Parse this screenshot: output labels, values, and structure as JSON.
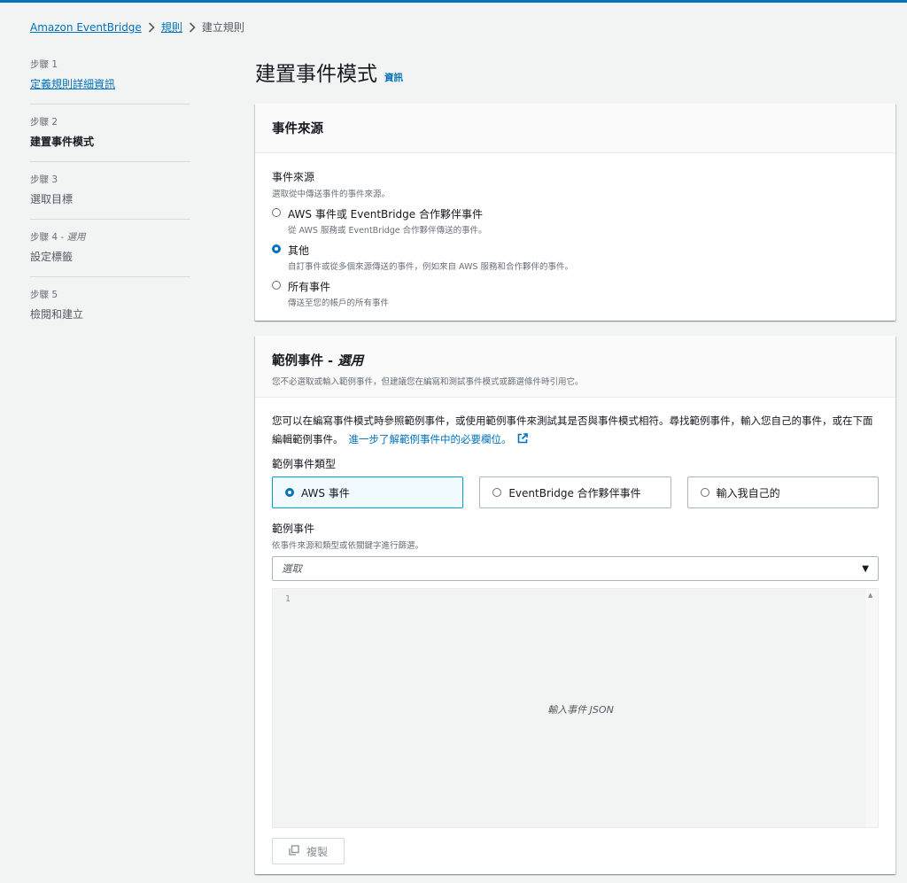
{
  "breadcrumb": {
    "items": [
      "Amazon EventBridge",
      "規則",
      "建立規則"
    ]
  },
  "steps": [
    {
      "num": "步驟 1",
      "opt": "",
      "title": "定義規則詳細資訊"
    },
    {
      "num": "步驟 2",
      "opt": "",
      "title": "建置事件模式"
    },
    {
      "num": "步驟 3",
      "opt": "",
      "title": "選取目標"
    },
    {
      "num": "步驟 4 - ",
      "opt": "選用",
      "title": "設定標籤"
    },
    {
      "num": "步驟 5",
      "opt": "",
      "title": "檢閱和建立"
    }
  ],
  "page": {
    "title": "建置事件模式",
    "info": "資訊"
  },
  "event_source_panel": {
    "header": "事件來源",
    "label": "事件來源",
    "description": "選取從中傳送事件的事件來源。",
    "options": [
      {
        "label": "AWS 事件或 EventBridge 合作夥伴事件",
        "desc": "從 AWS 服務或 EventBridge 合作夥伴傳送的事件。",
        "checked": false
      },
      {
        "label": "其他",
        "desc": "自訂事件或從多個來源傳送的事件，例如來自 AWS 服務和合作夥伴的事件。",
        "checked": true
      },
      {
        "label": "所有事件",
        "desc": "傳送至您的帳戶的所有事件",
        "checked": false
      }
    ]
  },
  "sample_panel": {
    "header": "範例事件 - ",
    "header_opt": "選用",
    "header_desc": "您不必選取或輸入範例事件，但建議您在編寫和測試事件模式或篩選條件時引用它。",
    "para1": "您可以在編寫事件模式時參照範例事件，或使用範例事件來測試其是否與事件模式相符。尋找範例事件，輸入您自己的事件，或在下面編輯範例事件。",
    "para_link": "進一步了解範例事件中的必要欄位。",
    "type_label": "範例事件類型",
    "types": [
      {
        "label": "AWS 事件",
        "selected": true
      },
      {
        "label": "EventBridge 合作夥伴事件",
        "selected": false
      },
      {
        "label": "輸入我自己的",
        "selected": false
      }
    ],
    "sample_label": "範例事件",
    "sample_desc": "依事件來源和類型或依關鍵字進行篩選。",
    "select_placeholder": "選取",
    "editor_line": "1",
    "editor_placeholder": "輸入事件 JSON",
    "copy_label": "複製"
  },
  "colors": {
    "link": "#0073bb",
    "selected_border": "#00a1c9",
    "page_bg": "#f2f3f3"
  },
  "icons": [
    "chevron-right-icon",
    "external-link-icon",
    "caret-down-icon",
    "copy-icon"
  ]
}
